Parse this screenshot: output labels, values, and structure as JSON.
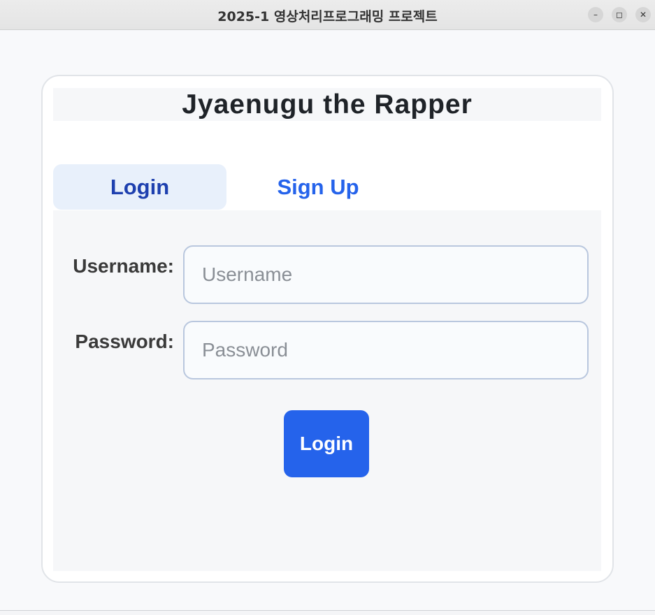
{
  "window": {
    "title": "2025-1 영상처리프로그래밍 프로젝트",
    "controls": {
      "minimize": "–",
      "maximize": "◻",
      "close": "✕"
    }
  },
  "app": {
    "title": "Jyaenugu the Rapper"
  },
  "tabs": [
    {
      "label": "Login",
      "active": true
    },
    {
      "label": "Sign Up",
      "active": false
    }
  ],
  "form": {
    "username_label": "Username:",
    "username_placeholder": "Username",
    "password_label": "Password:",
    "password_placeholder": "Password",
    "submit_label": "Login"
  },
  "colors": {
    "accent": "#2563eb",
    "active_tab_bg": "#e8f0fb",
    "active_tab_text": "#1e40af"
  }
}
